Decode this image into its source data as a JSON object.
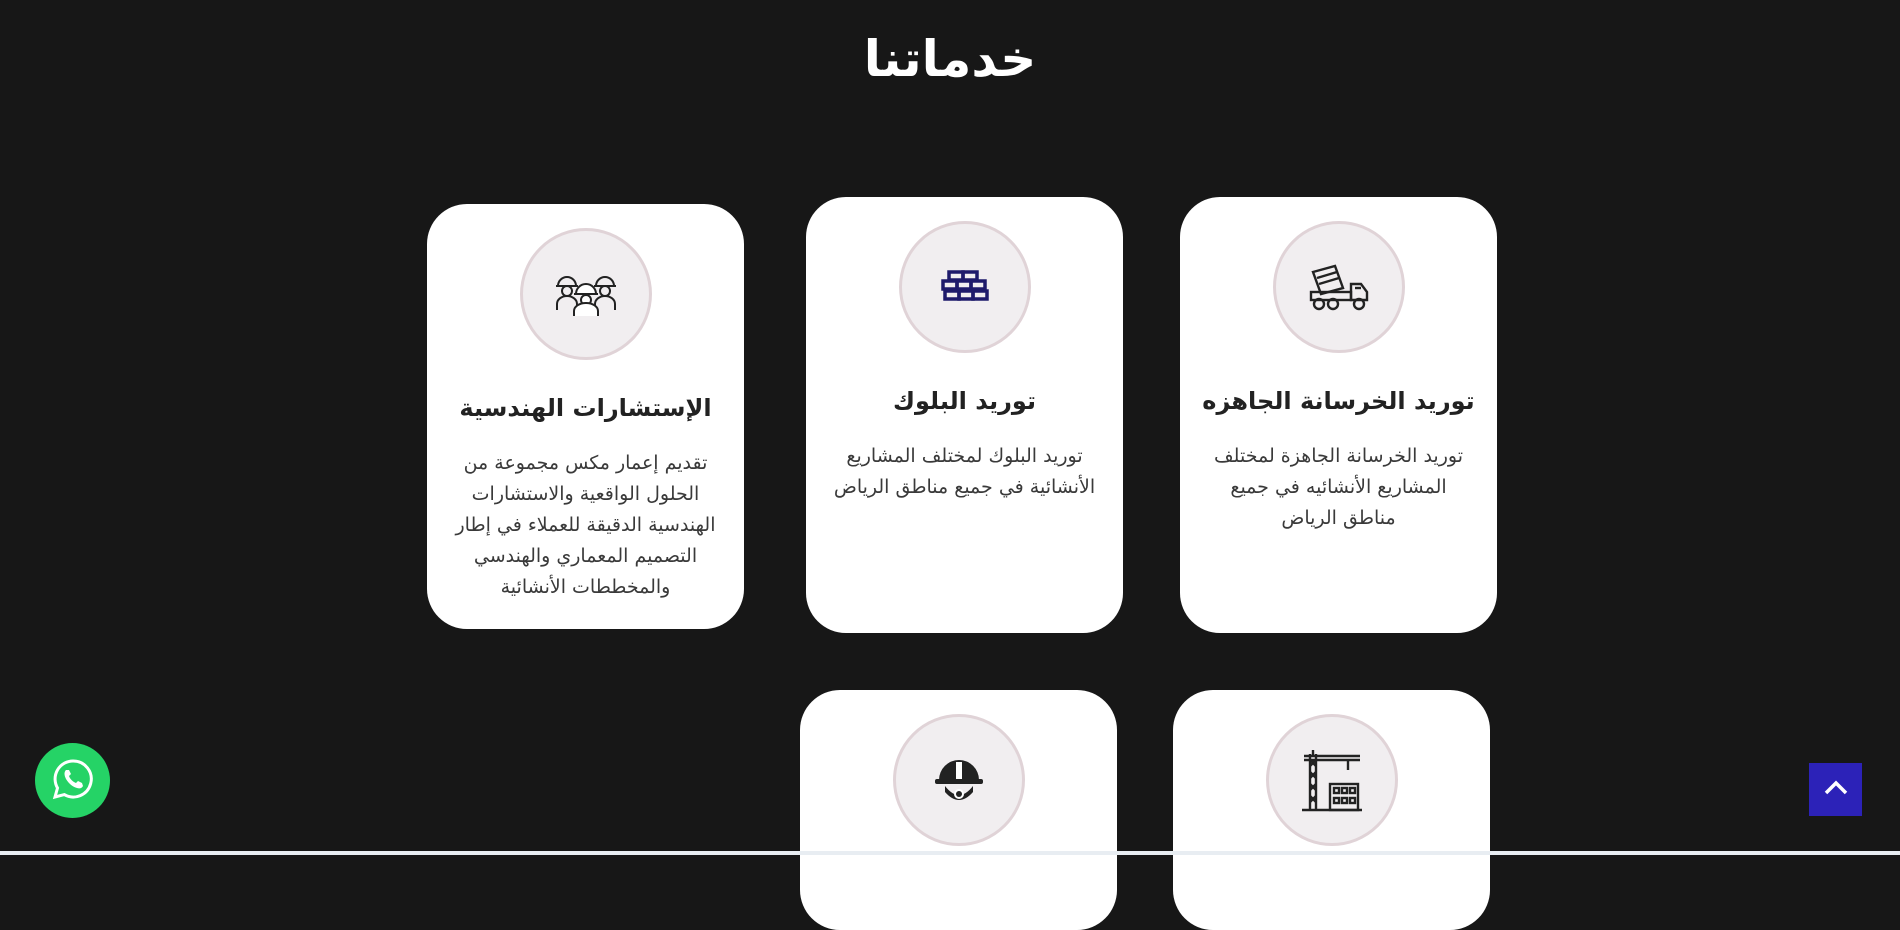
{
  "section": {
    "title": "خدماتنا"
  },
  "services": [
    {
      "title": "الإستشارات الهندسية",
      "description": "تقديم إعمار مكس مجموعة من الحلول الواقعية والاستشارات الهندسية الدقيقة للعملاء في إطار التصميم المعماري والهندسي والمخططات الأنشائية",
      "icon": "engineers-team-icon"
    },
    {
      "title": "توريد البلوك",
      "description": "توريد البلوك لمختلف المشاريع الأنشائية في جميع مناطق الرياض",
      "icon": "bricks-icon",
      "icon_color": "#1e1a6b"
    },
    {
      "title": "توريد الخرسانة الجاهزه",
      "description": "توريد الخرسانة الجاهزة لمختلف المشاريع الأنشائيه في جميع مناطق الرياض",
      "icon": "concrete-mixer-truck-icon"
    },
    {
      "icon": "safety-helmet-icon"
    },
    {
      "icon": "construction-crane-icon"
    }
  ],
  "widgets": {
    "whatsapp": {
      "icon": "whatsapp-icon",
      "color": "#25d366"
    },
    "scroll_top": {
      "icon": "chevron-up-icon",
      "color": "#2c22b8"
    }
  }
}
